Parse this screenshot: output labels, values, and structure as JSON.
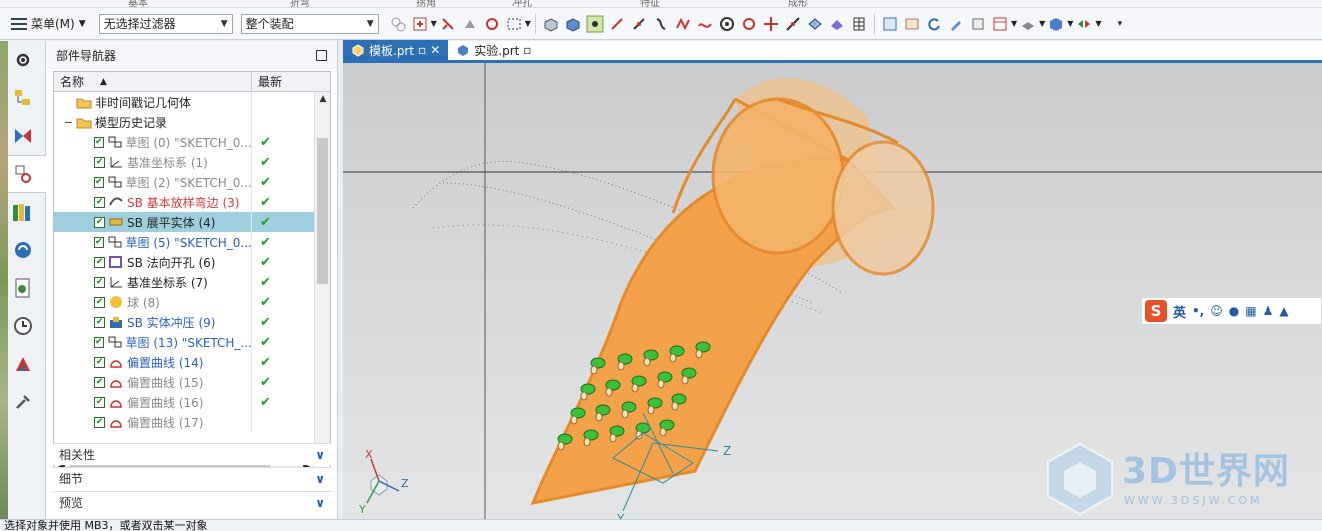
{
  "ribbon_tabs": [
    "基本",
    "折弯",
    "拐角",
    "冲孔",
    "特征",
    "成形"
  ],
  "toolbar": {
    "menu_label": "菜单(M)",
    "filter_value": "无选择过滤器",
    "scope_value": "整个装配"
  },
  "navigator": {
    "title": "部件导航器",
    "col_name": "名称",
    "col_latest": "最新",
    "rows": [
      {
        "label": "非时间戳记几何体",
        "style": "black",
        "check": false,
        "icon": "folder",
        "level": 1,
        "status": ""
      },
      {
        "label": "模型历史记录",
        "style": "black",
        "check": false,
        "icon": "folder",
        "level": 1,
        "status": "",
        "expanded": true
      },
      {
        "label": "草图 (0) \"SKETCH_0...",
        "style": "gray",
        "check": true,
        "icon": "sketch",
        "level": 2,
        "status": "✔"
      },
      {
        "label": "基准坐标系 (1)",
        "style": "gray",
        "check": true,
        "icon": "datum",
        "level": 2,
        "status": "✔"
      },
      {
        "label": "草图 (2) \"SKETCH_0...",
        "style": "gray",
        "check": true,
        "icon": "sketch",
        "level": 2,
        "status": "✔"
      },
      {
        "label": "SB 基本放样弯边 (3)",
        "style": "red",
        "check": true,
        "icon": "flange",
        "level": 2,
        "status": "✔"
      },
      {
        "label": "SB 展平实体 (4)",
        "style": "black",
        "check": true,
        "icon": "flat",
        "level": 2,
        "status": "✔",
        "selected": true
      },
      {
        "label": "草图 (5) \"SKETCH_0...",
        "style": "blue",
        "check": true,
        "icon": "sketch",
        "level": 2,
        "status": "✔"
      },
      {
        "label": "SB 法向开孔 (6)",
        "style": "black",
        "check": true,
        "icon": "cutout",
        "level": 2,
        "status": "✔"
      },
      {
        "label": "基准坐标系 (7)",
        "style": "black",
        "check": true,
        "icon": "datum",
        "level": 2,
        "status": "✔"
      },
      {
        "label": "球 (8)",
        "style": "gray",
        "check": true,
        "icon": "sphere",
        "level": 2,
        "status": "✔"
      },
      {
        "label": "SB 实体冲压 (9)",
        "style": "blue",
        "check": true,
        "icon": "punch",
        "level": 2,
        "status": "✔"
      },
      {
        "label": "草图 (13) \"SKETCH_...",
        "style": "blue",
        "check": true,
        "icon": "sketch",
        "level": 2,
        "status": "✔"
      },
      {
        "label": "偏置曲线 (14)",
        "style": "blue",
        "check": true,
        "icon": "curve",
        "level": 2,
        "status": "✔"
      },
      {
        "label": "偏置曲线 (15)",
        "style": "gray",
        "check": true,
        "icon": "curve",
        "level": 2,
        "status": "✔"
      },
      {
        "label": "偏置曲线 (16)",
        "style": "gray",
        "check": true,
        "icon": "curve",
        "level": 2,
        "status": "✔"
      },
      {
        "label": "偏置曲线 (17)",
        "style": "gray",
        "check": true,
        "icon": "curve",
        "level": 2,
        "status": ""
      }
    ],
    "accordions": [
      "相关性",
      "细节",
      "预览"
    ]
  },
  "tabs": [
    {
      "label": "模板.prt",
      "active": true
    },
    {
      "label": "实验.prt",
      "active": false
    }
  ],
  "viewport": {
    "triad_x": "X",
    "triad_y": "Y",
    "triad_z": "Z",
    "csys_y": "Y",
    "csys_z": "Z"
  },
  "ime": {
    "lang_label": "英"
  },
  "watermark": {
    "title": "3D世界网",
    "url": "WWW.3DSJW.COM"
  },
  "status": {
    "prompt": "选择对象并使用 MB3，或者双击某一对象"
  },
  "colors": {
    "accent": "#2d6fb5",
    "part": "#f4a24a",
    "part_edge": "#e58a2a",
    "selection": "#9fcfde"
  }
}
